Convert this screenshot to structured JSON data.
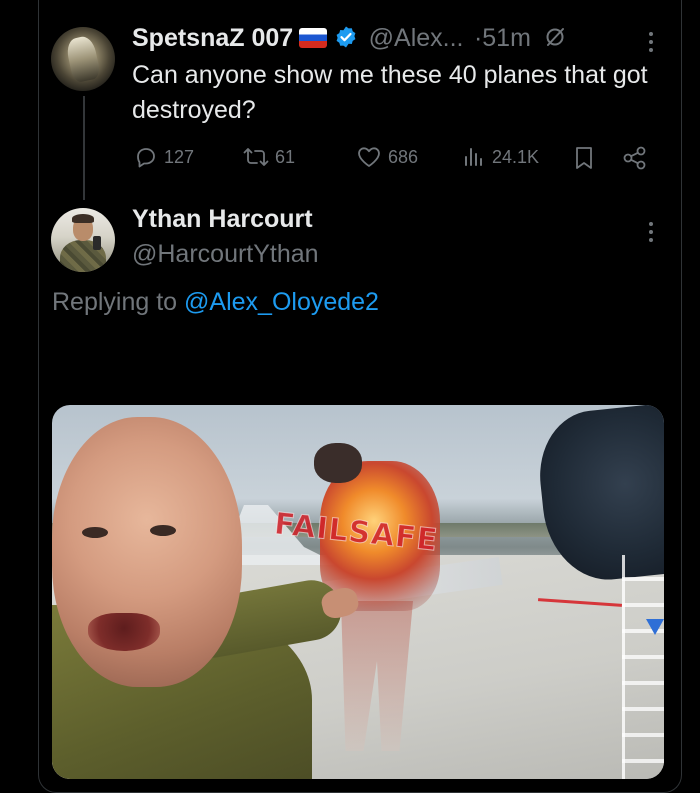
{
  "tweet": {
    "author_name": "SpetsnaZ 007",
    "handle": "@Alex...",
    "separator": "·",
    "time": "51m",
    "text": "Can anyone show me these 40 planes that got destroyed?",
    "stats": {
      "replies": "127",
      "retweets": "61",
      "likes": "686",
      "views": "24.1K"
    }
  },
  "reply": {
    "author_name": "Ythan Harcourt",
    "handle": "@HarcourtYthan",
    "replying_prefix": "Replying to ",
    "replying_mention": "@Alex_Oloyede2",
    "media_overlay_text": "FAILSAFE"
  },
  "colors": {
    "background": "#000000",
    "text_primary": "#e7e9ea",
    "text_secondary": "#71767b",
    "accent_blue": "#1d9bf0",
    "verified_blue": "#1d9bf0"
  },
  "icons": {
    "reply": "reply-icon",
    "retweet": "retweet-icon",
    "like": "heart-icon",
    "views": "bar-chart-icon",
    "bookmark": "bookmark-icon",
    "share": "share-icon",
    "more": "more-options-icon",
    "grok": "grok-icon",
    "verified": "verified-badge-icon",
    "flag": "russia-flag-icon"
  }
}
